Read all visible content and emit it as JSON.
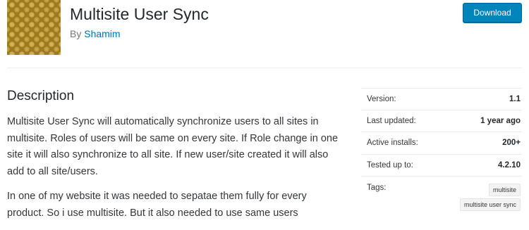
{
  "header": {
    "title": "Multisite User Sync",
    "by_prefix": "By",
    "author": "Shamim",
    "download_label": "Download"
  },
  "description": {
    "heading": "Description",
    "paragraphs": [
      "Multisite User Sync will automatically synchronize users to all sites in multisite. Roles of users will be same on every site. If Role change in one site it will also synchronize to all site. If new user/site created it will also add to all site/users.",
      "In one of my website it was needed to sepatae them fully for every product. So i use multisite. But it also needed to use same users"
    ]
  },
  "meta": {
    "version": {
      "label": "Version:",
      "value": "1.1"
    },
    "last_updated": {
      "label": "Last updated:",
      "value": "1 year ago"
    },
    "active_installs": {
      "label": "Active installs:",
      "value": "200+"
    },
    "tested_up_to": {
      "label": "Tested up to:",
      "value": "4.2.10"
    },
    "tags_label": "Tags:",
    "tags": [
      "multisite",
      "multisite user sync"
    ]
  },
  "colors": {
    "accent": "#0085ba",
    "link": "#0073aa",
    "text": "#32373c"
  }
}
